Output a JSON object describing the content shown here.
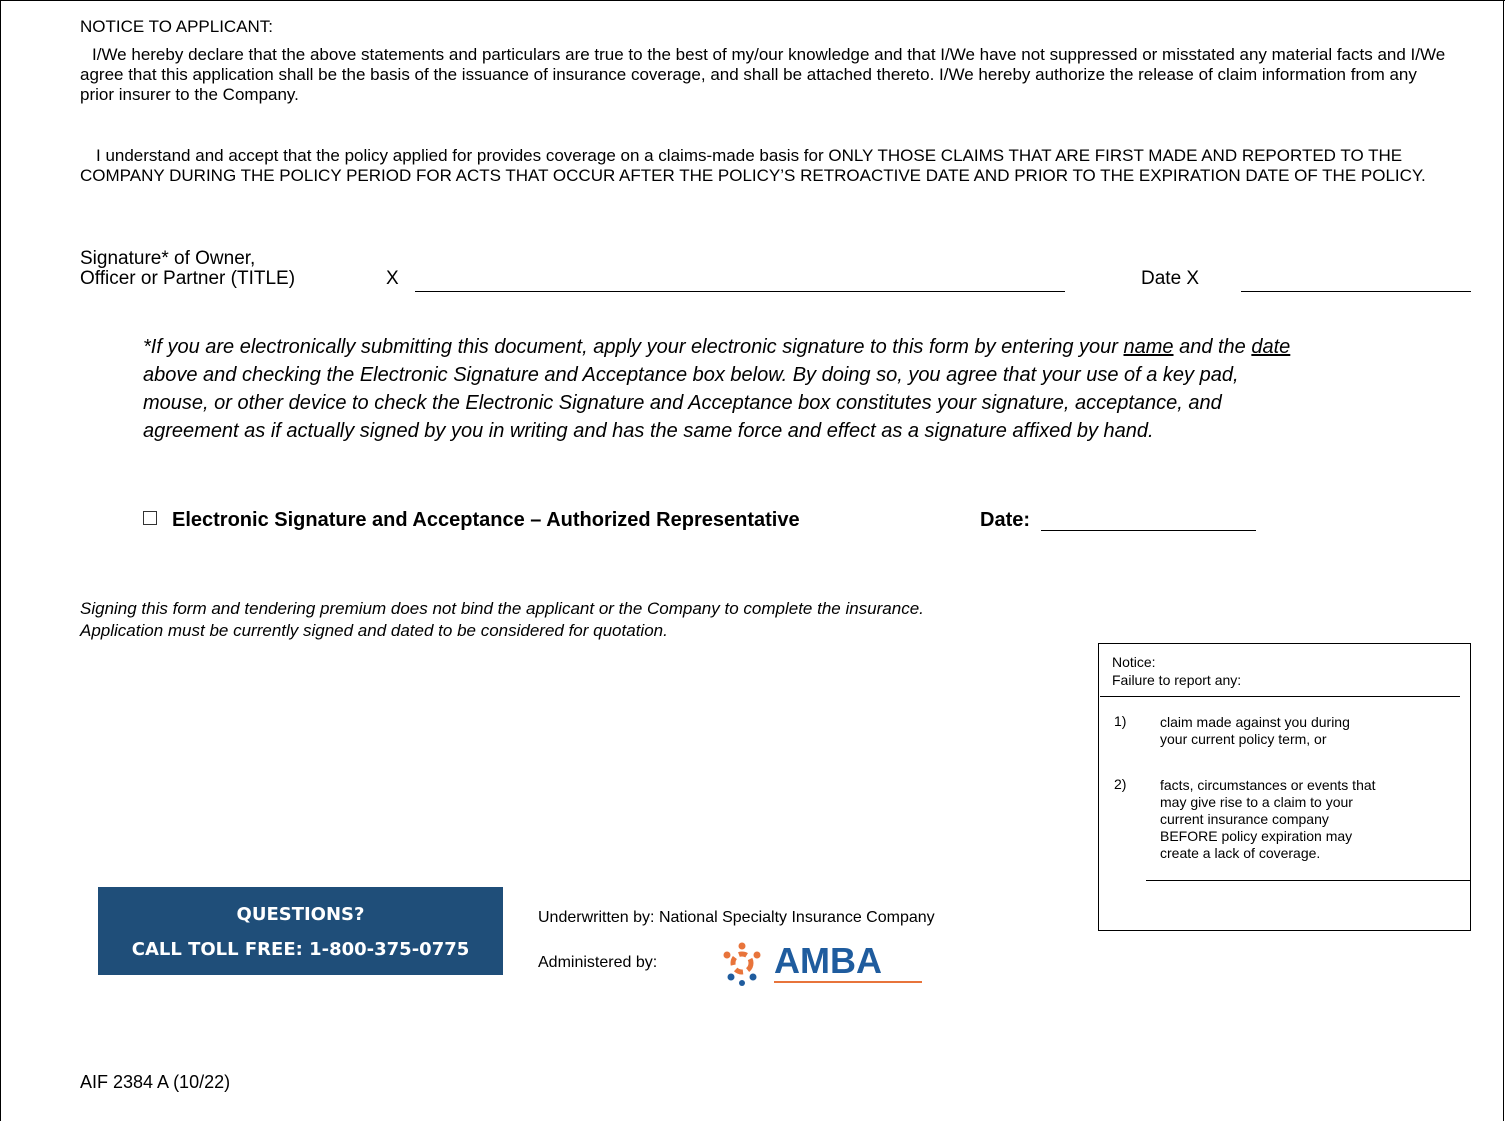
{
  "notice": {
    "title": "NOTICE TO APPLICANT:",
    "paragraph1": "I/We hereby declare that the above statements and particulars are true to the best of my/our knowledge and that I/We have not suppressed or misstated any material facts and I/We agree that this application shall be the basis of the issuance of insurance coverage, and shall be attached thereto.  I/We hereby authorize the release of claim information from any prior insurer to the Company.",
    "paragraph2": "I understand and accept that the policy applied for provides coverage on a claims-made basis for ONLY THOSE CLAIMS THAT ARE FIRST MADE AND REPORTED TO THE COMPANY DURING THE POLICY PERIOD FOR ACTS THAT OCCUR AFTER THE POLICY’S RETROACTIVE DATE AND PRIOR TO THE EXPIRATION DATE OF THE POLICY."
  },
  "signature": {
    "label_line1": "Signature* of Owner,",
    "label_line2": "Officer or Partner (TITLE)",
    "x_mark": "X",
    "date_label": "Date",
    "date_x_mark": "X"
  },
  "electronic": {
    "text_a": "*If you are electronically submitting this document, apply your electronic signature to this form by entering your ",
    "name_word": "name",
    "text_b": " and the ",
    "date_word": "date",
    "text_c": " above and checking the Electronic Signature and Acceptance box below. By doing so, you agree that your use of a key pad, mouse, or other device to check the Electronic Signature and Acceptance box constitutes your signature, acceptance, and agreement as if actually signed by you in writing and has the same force and effect as a signature affixed by hand.",
    "checkbox_label": "Electronic Signature and Acceptance – Authorized Representative",
    "date_label": "Date:"
  },
  "binding": {
    "line1": "Signing this form and tendering premium does not bind the applicant or the Company to complete the insurance.",
    "line2": "Application must be currently signed and dated to be considered for quotation."
  },
  "notice_box": {
    "title": "Notice:",
    "subtitle": "Failure to report any:",
    "items": [
      {
        "num": "1)",
        "lines": [
          "claim made against  you during",
          "your current policy term, or"
        ]
      },
      {
        "num": "2)",
        "lines": [
          "facts, circumstances or events that",
          "may give rise to a claim to your",
          "current insurance company",
          "BEFORE policy expiration may",
          "create a lack of coverage."
        ]
      }
    ]
  },
  "questions": {
    "line1": "QUESTIONS?",
    "line2": "CALL TOLL FREE: 1-800-375-0775",
    "bg_color": "#1f4e79"
  },
  "underwriter": {
    "underwritten_label": "Underwritten by:",
    "underwritten_company": "National Specialty Insurance Company",
    "administered_label": "Administered by:",
    "logo_text": "AMBA",
    "logo_color": "#1f5c9e",
    "logo_accent_color": "#e8743b"
  },
  "form_code": "AIF 2384 A (10/22)"
}
